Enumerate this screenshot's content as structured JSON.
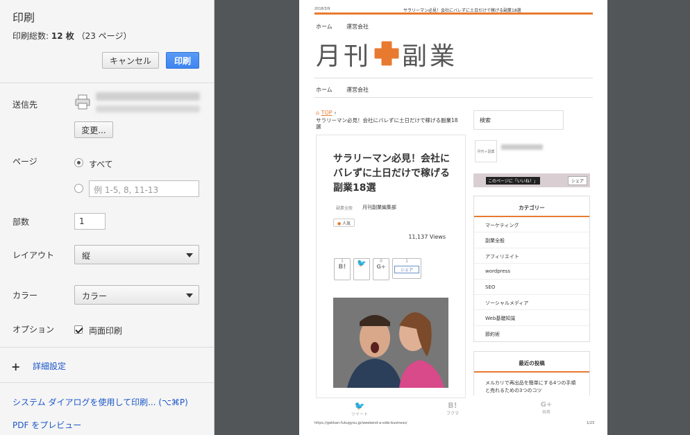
{
  "panel": {
    "title": "印刷",
    "total_label": "印刷総数:",
    "total_value": "12 枚",
    "total_pages": "（23 ページ）",
    "cancel_label": "キャンセル",
    "print_label": "印刷",
    "destination_label": "送信先",
    "change_label": "変更...",
    "pages_label": "ページ",
    "pages_all_label": "すべて",
    "pages_range_placeholder": "例 1-5, 8, 11-13",
    "copies_label": "部数",
    "copies_value": "1",
    "layout_label": "レイアウト",
    "layout_value": "縦",
    "color_label": "カラー",
    "color_value": "カラー",
    "options_label": "オプション",
    "duplex_label": "両面印刷",
    "duplex_checked": true,
    "advanced_label": "詳細設定",
    "system_dialog_label": "システム ダイアログを使用して印刷... (⌥⌘P)",
    "pdf_preview_label": "PDF をプレビュー"
  },
  "preview": {
    "date": "2018/3/9",
    "header_title": "サラリーマン必見！会社にバレずに土日だけで稼げる副業18選",
    "nav_home": "ホーム",
    "nav_company": "運営会社",
    "logo_left": "月刊",
    "logo_right": "副業",
    "breadcrumb_top": "TOP",
    "breadcrumb_current": "サラリーマン必見！会社にバレずに土日だけで稼げる副業18選",
    "article_title": "サラリーマン必見！会社にバレずに土日だけで稼げる副業18選",
    "category": "副業全般",
    "author": "月刊副業編集部",
    "tag": "人気",
    "views": "11,137 Views",
    "share_b_count": "1",
    "share_g_count": "0",
    "share_fb_count": "1",
    "share_fb_label": "シェア",
    "search_label": "検索",
    "banner_text": "このページに「いいね！」",
    "banner_share": "シェア",
    "category_title": "カテゴリー",
    "categories": [
      "マーケティング",
      "副業全般",
      "アフィリエイト",
      "wordpress",
      "SEO",
      "ソーシャルメディア",
      "Web基礎知識",
      "節約術"
    ],
    "recent_title": "最近の投稿",
    "recent_post": "メルカリで再出品を簡単にする4つの手順と売れるための3つのコツ",
    "footer_tweet": "ツイート",
    "footer_bookmark": "ブクマ",
    "footer_share": "共有",
    "url": "https://gekkan-fukugyou.jp/weekend-a-side-business/",
    "page_num": "1/23"
  },
  "colors": {
    "accent_orange": "#e87a2f",
    "print_button_blue": "#3d85f0",
    "link_blue": "#1a56c8",
    "preview_bg": "#525659"
  }
}
